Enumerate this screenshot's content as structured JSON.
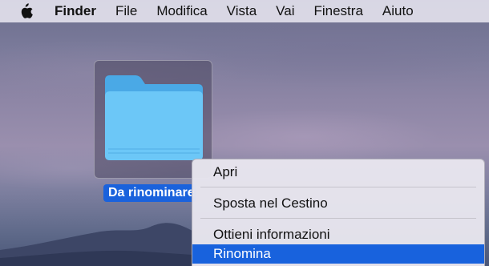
{
  "menubar": {
    "app_name": "Finder",
    "items": [
      "File",
      "Modifica",
      "Vista",
      "Vai",
      "Finestra",
      "Aiuto"
    ]
  },
  "desktop": {
    "folder": {
      "name": "Da rinominare",
      "icon": "folder-icon"
    }
  },
  "context_menu": {
    "items": [
      {
        "label": "Apri"
      },
      {
        "label": "Sposta nel Cestino"
      },
      {
        "label": "Ottieni informazioni"
      },
      {
        "label": "Rinomina",
        "selected": true
      }
    ]
  },
  "colors": {
    "selection": "#1862dd",
    "folder_blue": "#5ec2f5"
  }
}
